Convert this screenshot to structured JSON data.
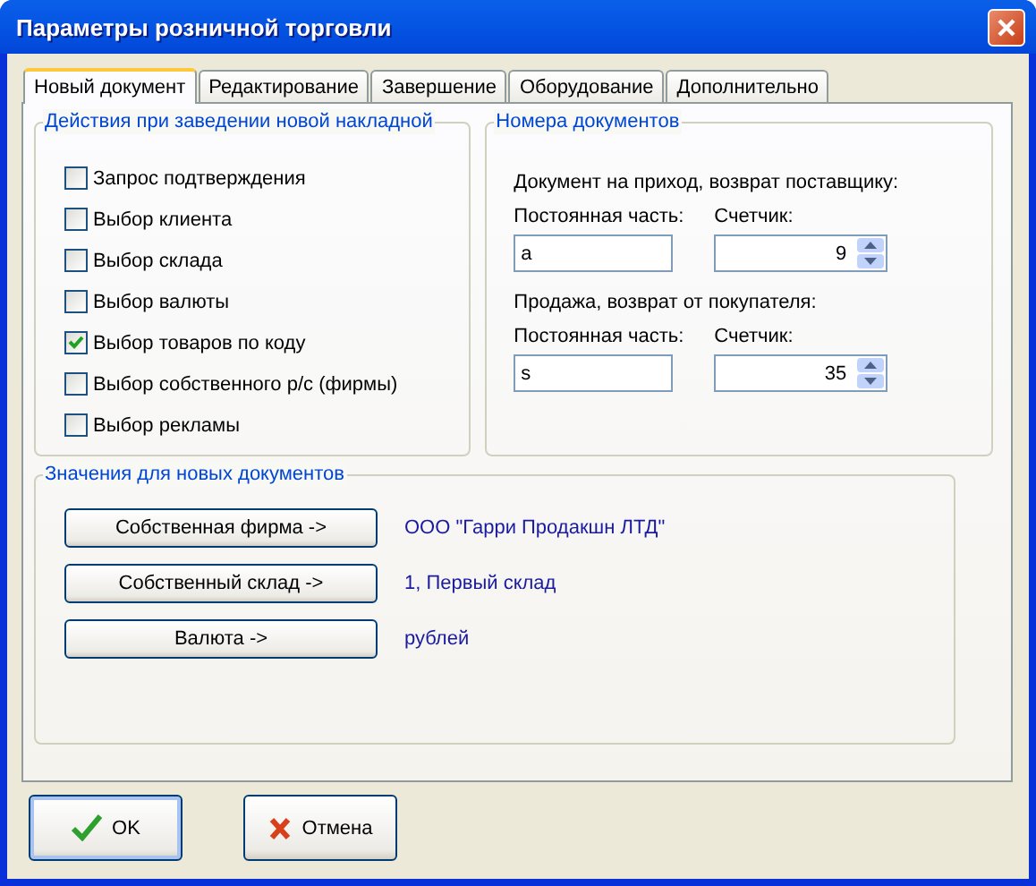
{
  "window": {
    "title": "Параметры розничной торговли"
  },
  "tabs": [
    {
      "label": "Новый документ",
      "selected": true
    },
    {
      "label": "Редактирование",
      "selected": false
    },
    {
      "label": "Завершение",
      "selected": false
    },
    {
      "label": "Оборудование",
      "selected": false
    },
    {
      "label": "Дополнительно",
      "selected": false
    }
  ],
  "actions_group": {
    "title": "Действия при заведении новой накладной",
    "options": [
      {
        "label": "Запрос подтверждения",
        "checked": false
      },
      {
        "label": "Выбор клиента",
        "checked": false
      },
      {
        "label": "Выбор склада",
        "checked": false
      },
      {
        "label": "Выбор валюты",
        "checked": false
      },
      {
        "label": "Выбор товаров по коду",
        "checked": true
      },
      {
        "label": "Выбор собственного р/с (фирмы)",
        "checked": false
      },
      {
        "label": "Выбор рекламы",
        "checked": false
      }
    ]
  },
  "numbers_group": {
    "title": "Номера документов",
    "sections": [
      {
        "heading": "Документ на приход, возврат поставщику:",
        "prefix_label": "Постоянная часть:",
        "prefix_value": "a",
        "counter_label": "Счетчик:",
        "counter_value": "9"
      },
      {
        "heading": "Продажа, возврат от покупателя:",
        "prefix_label": "Постоянная часть:",
        "prefix_value": "s",
        "counter_label": "Счетчик:",
        "counter_value": "35"
      }
    ]
  },
  "defaults_group": {
    "title": "Значения для новых документов",
    "rows": [
      {
        "button": "Собственная фирма ->",
        "value": "ООО \"Гарри Продакшн ЛТД\""
      },
      {
        "button": "Собственный склад ->",
        "value": "1, Первый склад"
      },
      {
        "button": "Валюта ->",
        "value": "рублей"
      }
    ]
  },
  "buttons": [
    {
      "label": "OK",
      "kind": "ok"
    },
    {
      "label": "Отмена",
      "kind": "cancel"
    }
  ]
}
